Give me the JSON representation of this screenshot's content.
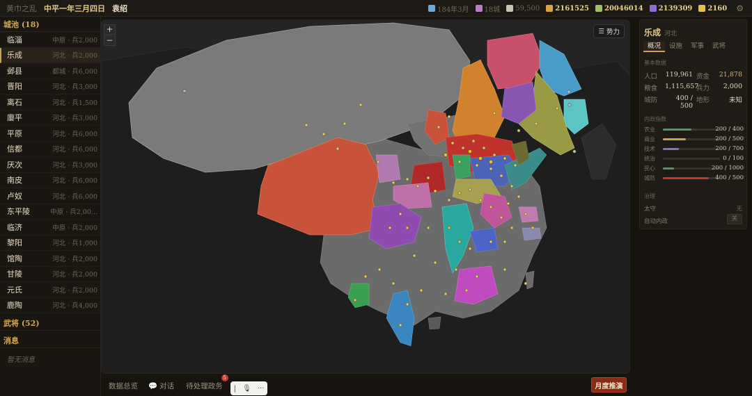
{
  "topbar": {
    "title": "黄巾之乱",
    "date": "中平一年三月四日",
    "ruler": "袁绍",
    "stats": [
      {
        "icon": "calendar-icon",
        "text": "184年3月",
        "dim": true,
        "color": "#6aa9d8"
      },
      {
        "icon": "castle-icon",
        "text": "18城",
        "dim": true,
        "color": "#c07ac8"
      },
      {
        "icon": "swords-icon",
        "text": "59,500",
        "dim": true,
        "color": "#c8c0b0"
      },
      {
        "icon": "money-bag-icon",
        "text": "2161525",
        "dim": false,
        "color": "#d9a441"
      },
      {
        "icon": "grain-icon",
        "text": "20046014",
        "dim": false,
        "color": "#9cc063"
      },
      {
        "icon": "crown-icon",
        "text": "2139309",
        "dim": false,
        "color": "#8b6fd4"
      },
      {
        "icon": "bulb-icon",
        "text": "2160",
        "dim": false,
        "color": "#e8c14a"
      }
    ]
  },
  "left": {
    "cities_header": "城池 (18)",
    "cities": [
      {
        "name": "临淄",
        "info": "中原 · 兵2,000"
      },
      {
        "name": "乐成",
        "info": "河北 · 兵2,000"
      },
      {
        "name": "邺县",
        "info": "都城 · 兵6,000"
      },
      {
        "name": "晋阳",
        "info": "河北 · 兵3,000"
      },
      {
        "name": "离石",
        "info": "河北 · 兵1,500"
      },
      {
        "name": "廮平",
        "info": "河北 · 兵3,000"
      },
      {
        "name": "平原",
        "info": "河北 · 兵6,000"
      },
      {
        "name": "信都",
        "info": "河北 · 兵6,000"
      },
      {
        "name": "厌次",
        "info": "河北 · 兵3,000"
      },
      {
        "name": "南皮",
        "info": "河北 · 兵6,000"
      },
      {
        "name": "卢奴",
        "info": "河北 · 兵6,000"
      },
      {
        "name": "东平陵",
        "info": "中原 · 兵2,00..."
      },
      {
        "name": "临济",
        "info": "中原 · 兵2,000"
      },
      {
        "name": "黎阳",
        "info": "河北 · 兵1,000"
      },
      {
        "name": "馆陶",
        "info": "河北 · 兵2,000"
      },
      {
        "name": "甘陵",
        "info": "河北 · 兵2,000"
      },
      {
        "name": "元氏",
        "info": "河北 · 兵2,000"
      },
      {
        "name": "鹿陶",
        "info": "河北 · 兵4,000"
      }
    ],
    "generals_header": "武将 (52)",
    "messages_header": "消息",
    "no_messages": "暂无消息"
  },
  "map": {
    "zoom_in": "+",
    "zoom_out": "−",
    "power_label": "势力"
  },
  "bottom": {
    "tab_overview": "数据总览",
    "tab_dialog": "对话",
    "tab_pending": "待处理政务",
    "pending_count": "5",
    "voice_cursor": "|",
    "voice_more": "···",
    "month_button": "月度推演"
  },
  "panel": {
    "city": "乐成",
    "region": "河北",
    "tabs": [
      "概况",
      "设施",
      "军事",
      "武将"
    ],
    "basic_title": "基本数据",
    "basic": [
      {
        "k": "人口",
        "v": "119,961",
        "k2": "资金",
        "v2": "21,878"
      },
      {
        "k": "粮食",
        "v": "1,115,657",
        "k2": "兵力",
        "v2": "2,000"
      },
      {
        "k": "城防",
        "v": "400 / 500",
        "k2": "地形",
        "v2": "未知"
      }
    ],
    "dev_title": "内政指数",
    "dev": [
      {
        "k": "农业",
        "v": "200 / 400",
        "ratio": 0.5,
        "color": "#4d9a5c"
      },
      {
        "k": "商业",
        "v": "200 / 500",
        "ratio": 0.4,
        "color": "#c9a24e"
      },
      {
        "k": "技术",
        "v": "200 / 700",
        "ratio": 0.2857,
        "color": "#8a74b8"
      },
      {
        "k": "统治",
        "v": "0 / 100",
        "ratio": 0,
        "color": "#888888"
      },
      {
        "k": "民心",
        "v": "200 / 1000",
        "ratio": 0.2,
        "color": "#4d9a5c"
      },
      {
        "k": "城防",
        "v": "400 / 500",
        "ratio": 0.8,
        "color": "#c23a2a"
      }
    ],
    "gov_title": "治理",
    "governor_label": "太守",
    "governor_value": "无",
    "auto_label": "自动内政",
    "auto_value": "关"
  }
}
